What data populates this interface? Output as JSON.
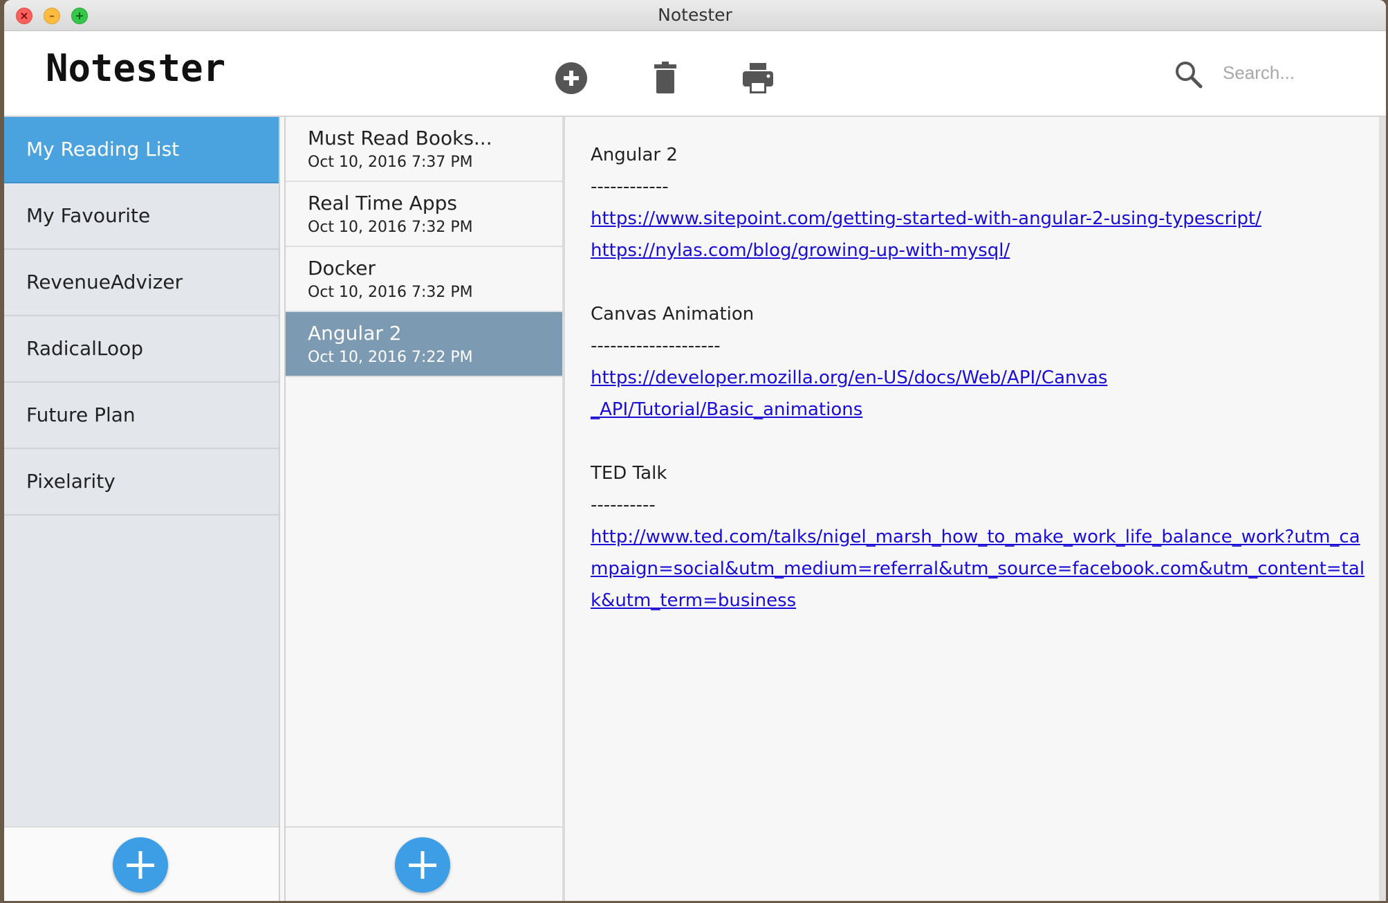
{
  "window": {
    "title": "Notester",
    "controls": [
      "close",
      "minimize",
      "zoom"
    ]
  },
  "toolbar": {
    "app_name": "Notester",
    "buttons": [
      {
        "name": "add-note",
        "icon": "plus-circle-icon"
      },
      {
        "name": "delete-note",
        "icon": "trash-icon"
      },
      {
        "name": "print-note",
        "icon": "printer-icon"
      }
    ],
    "search": {
      "placeholder": "Search...",
      "value": ""
    }
  },
  "sidebar": {
    "items": [
      {
        "label": "My Reading List",
        "active": true
      },
      {
        "label": "My Favourite"
      },
      {
        "label": "RevenueAdvizer"
      },
      {
        "label": "RadicalLoop"
      },
      {
        "label": "Future Plan"
      },
      {
        "label": "Pixelarity"
      }
    ]
  },
  "notes": {
    "items": [
      {
        "title": "Must Read Books...",
        "date": "Oct 10, 2016 7:37 PM"
      },
      {
        "title": "Real Time Apps",
        "date": "Oct 10, 2016 7:32 PM"
      },
      {
        "title": "Docker",
        "date": "Oct 10, 2016 7:32 PM"
      },
      {
        "title": "Angular 2",
        "date": "Oct 10, 2016 7:22 PM",
        "active": true
      }
    ]
  },
  "editor": {
    "sections": [
      {
        "heading": "Angular 2",
        "rule": "------------",
        "links": [
          "https://www.sitepoint.com/getting-started-with-angular-2-using-typescript/",
          "https://nylas.com/blog/growing-up-with-mysql/"
        ]
      },
      {
        "heading": "Canvas Animation",
        "rule": "--------------------",
        "links": [
          "https://developer.mozilla.org/en-US/docs/Web/API/Canvas_API/Tutorial/Basic_animations"
        ]
      },
      {
        "heading": "TED Talk",
        "rule": "----------",
        "links": [
          "http://www.ted.com/talks/nigel_marsh_how_to_make_work_life_balance_work?utm_campaign=social&utm_medium=referral&utm_source=facebook.com&utm_content=talk&utm_term=business"
        ]
      }
    ]
  },
  "colors": {
    "accent": "#4aa3df",
    "selected_note": "#7d9ab3",
    "fab": "#3d9ee5",
    "link": "#1a0dd6"
  }
}
